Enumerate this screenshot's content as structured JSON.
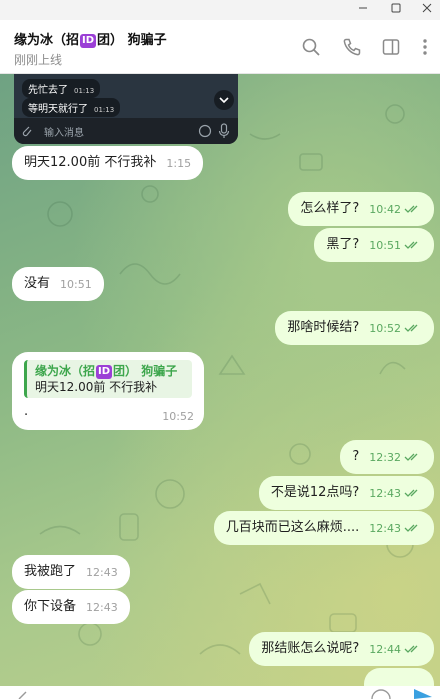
{
  "window": {
    "minimize_icon": "minimize-icon",
    "maximize_icon": "maximize-icon",
    "close_icon": "close-icon"
  },
  "header": {
    "title_pre": "缘为冰（招",
    "title_badge": "ID",
    "title_post": "团） 狗骗子",
    "status": "刚刚上线",
    "icons": [
      "search-icon",
      "phone-icon",
      "sidebar-toggle-icon",
      "more-icon"
    ]
  },
  "media_preview": {
    "lines": [
      {
        "text": "先忙去了",
        "time": "01:13"
      },
      {
        "text": "等明天就行了",
        "time": "01:13"
      }
    ],
    "input_placeholder": "输入消息"
  },
  "messages": [
    {
      "dir": "in",
      "text": "明天12.00前 不行我补",
      "time": "1:15"
    },
    {
      "dir": "out",
      "text": "怎么样了?",
      "time": "10:42"
    },
    {
      "dir": "out",
      "text": "黑了?",
      "time": "10:51"
    },
    {
      "dir": "in",
      "text": "没有",
      "time": "10:51"
    },
    {
      "dir": "out",
      "text": "那啥时候结?",
      "time": "10:52"
    },
    {
      "dir": "out",
      "text": "?",
      "time": "12:32"
    },
    {
      "dir": "out",
      "text": "不是说12点吗?",
      "time": "12:43"
    },
    {
      "dir": "out",
      "text": "几百块而已这么麻烦....",
      "time": "12:43"
    },
    {
      "dir": "in",
      "text": "我被跑了",
      "time": "12:43"
    },
    {
      "dir": "in",
      "text": "你下设备",
      "time": "12:43"
    },
    {
      "dir": "out",
      "text": "那结账怎么说呢?",
      "time": "12:44"
    }
  ],
  "reply_message": {
    "quote_name_pre": "缘为冰（招",
    "quote_badge": "ID",
    "quote_name_post": "团） 狗骗子",
    "quote_text": "明天12.00前 不行我补",
    "text": ".",
    "time": "10:52"
  },
  "colors": {
    "incoming": "#ffffff",
    "outgoing": "#eeffde",
    "accent": "#3da64c",
    "time_out": "#5aa860"
  }
}
